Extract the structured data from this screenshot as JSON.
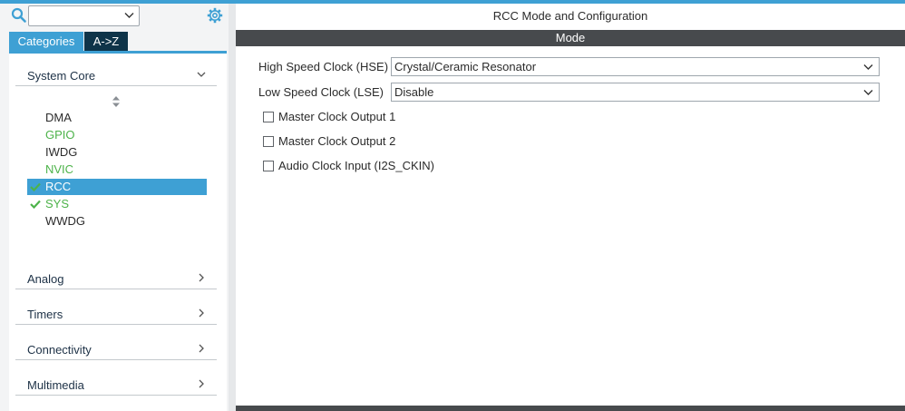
{
  "sidebar": {
    "search": {
      "value": ""
    },
    "tabs": {
      "categories": "Categories",
      "az": "A->Z"
    },
    "system_core": {
      "label": "System Core",
      "items": [
        {
          "label": "DMA",
          "state": "plain"
        },
        {
          "label": "GPIO",
          "state": "green"
        },
        {
          "label": "IWDG",
          "state": "plain"
        },
        {
          "label": "NVIC",
          "state": "green"
        },
        {
          "label": "RCC",
          "state": "selected-checked"
        },
        {
          "label": "SYS",
          "state": "green-checked"
        },
        {
          "label": "WWDG",
          "state": "plain"
        }
      ]
    },
    "categories": [
      {
        "label": "Analog"
      },
      {
        "label": "Timers"
      },
      {
        "label": "Connectivity"
      },
      {
        "label": "Multimedia"
      }
    ]
  },
  "main": {
    "title": "RCC Mode and Configuration",
    "mode_header": "Mode",
    "hse": {
      "label": "High Speed Clock (HSE)",
      "value": "Crystal/Ceramic Resonator"
    },
    "lse": {
      "label": "Low Speed Clock (LSE)",
      "value": "Disable"
    },
    "checkboxes": [
      {
        "label": "Master Clock Output 1",
        "checked": false
      },
      {
        "label": "Master Clock Output 2",
        "checked": false
      },
      {
        "label": "Audio Clock Input (I2S_CKIN)",
        "checked": false
      }
    ]
  },
  "colors": {
    "accent": "#3ea0d4",
    "dark_tab": "#0f3449",
    "mode_bar": "#474a4d",
    "enabled_green": "#4db34a"
  }
}
